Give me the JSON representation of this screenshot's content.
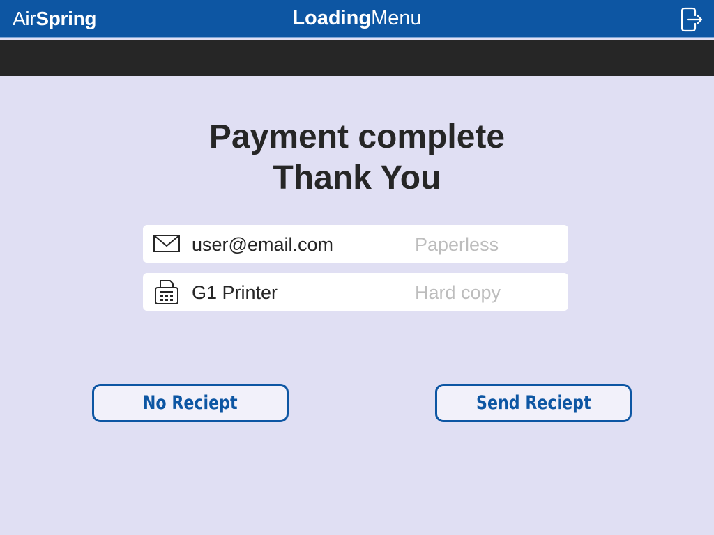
{
  "header": {
    "brand_light": "Air",
    "brand_bold": "Spring",
    "title_bold": "Loading",
    "title_light": "Menu",
    "logout_icon": "logout-icon"
  },
  "main": {
    "heading_line1": "Payment complete",
    "heading_line2": "Thank You",
    "options": [
      {
        "icon": "envelope-icon",
        "value": "user@email.com",
        "hint": "Paperless"
      },
      {
        "icon": "printer-icon",
        "value": "G1 Printer",
        "hint": "Hard copy"
      }
    ],
    "buttons": {
      "no_receipt": "No Reciept",
      "send_receipt": "Send Reciept"
    }
  },
  "colors": {
    "header_bg": "#0d56a3",
    "subbar_bg": "#262626",
    "page_bg": "#e0dff3",
    "accent": "#0d56a3",
    "hint_text": "#bdbdbd"
  }
}
